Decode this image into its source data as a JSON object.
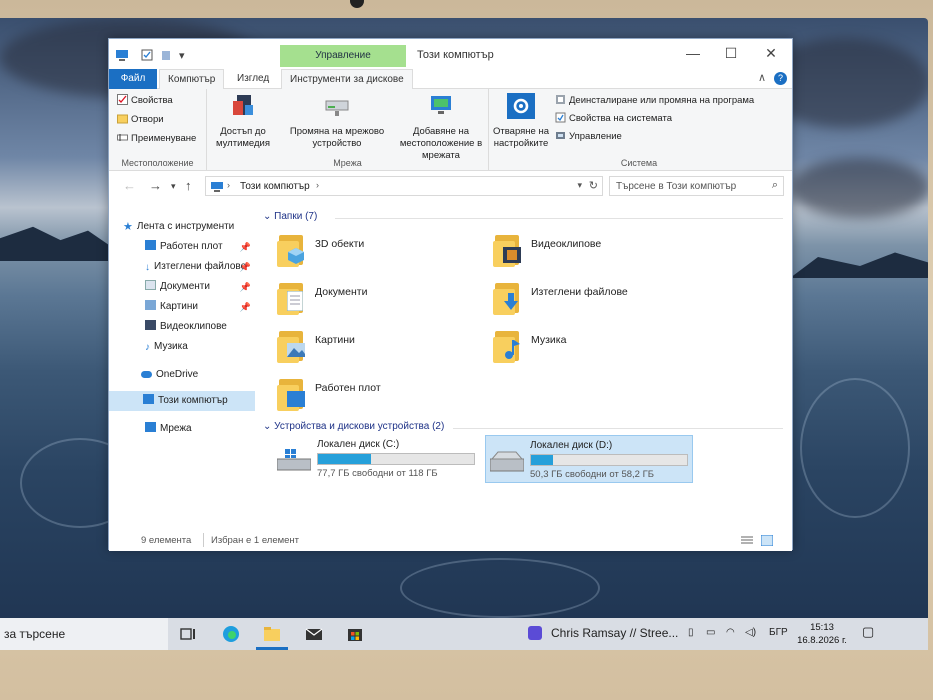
{
  "window": {
    "context_tab": "Управление",
    "title": "Този компютър"
  },
  "tabs": {
    "file": "Файл",
    "computer": "Компютър",
    "view": "Изглед",
    "disk_tools": "Инструменти за дискове"
  },
  "ribbon": {
    "location_group": {
      "title": "Местоположение",
      "properties": "Свойства",
      "open": "Отвори",
      "rename": "Преименуване"
    },
    "network_group": {
      "title": "Мрежа",
      "media_access_1": "Достъп до",
      "media_access_2": "мултимедия",
      "map_drive_1": "Промяна на мрежово",
      "map_drive_2": "устройство",
      "add_location_1": "Добавяне на",
      "add_location_2": "местоположение в мрежата"
    },
    "system_group": {
      "title": "Система",
      "open_settings_1": "Отваряне на",
      "open_settings_2": "настройките",
      "uninstall": "Деинсталиране или промяна на програма",
      "system_properties": "Свойства на системата",
      "manage": "Управление"
    }
  },
  "address": {
    "path": "Този компютър",
    "search_placeholder": "Търсене в Този компютър"
  },
  "nav": {
    "quick_access": "Лента с инструменти",
    "desktop": "Работен плот",
    "downloads": "Изтеглени файлове",
    "documents": "Документи",
    "pictures": "Картини",
    "videos": "Видеоклипове",
    "music": "Музика",
    "onedrive": "OneDrive",
    "this_pc": "Този компютър",
    "network": "Мрежа"
  },
  "content": {
    "folders_header": "Папки (7)",
    "folders": [
      {
        "label": "3D обекти"
      },
      {
        "label": "Видеоклипове"
      },
      {
        "label": "Документи"
      },
      {
        "label": "Изтеглени файлове"
      },
      {
        "label": "Картини"
      },
      {
        "label": "Музика"
      },
      {
        "label": "Работен плот"
      }
    ],
    "devices_header": "Устройства и дискови устройства (2)",
    "drives": [
      {
        "label": "Локален диск (C:)",
        "free": "77,7 ГБ свободни от 118 ГБ",
        "used_fraction": 0.34
      },
      {
        "label": "Локален диск (D:)",
        "free": "50,3 ГБ свободни от 58,2 ГБ",
        "used_fraction": 0.14
      }
    ]
  },
  "status": {
    "items": "9 елемента",
    "selected": "Избран е 1 елемент"
  },
  "taskbar": {
    "search": "за търсене",
    "media_title": "Chris Ramsay // Stree...",
    "language": "БГР",
    "time": "15:13",
    "date": "16.8.2026 г."
  },
  "colors": {
    "accent": "#1b6fc3",
    "context_tab": "#a5e08f",
    "folder": "#f8cf5e",
    "drive_bar": "#26a0da",
    "selection": "#cce4f7"
  }
}
